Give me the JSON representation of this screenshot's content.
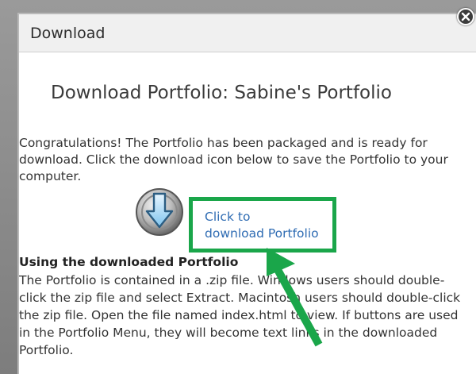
{
  "dialog": {
    "title": "Download",
    "close_icon": "close-icon"
  },
  "content": {
    "heading": "Download Portfolio: Sabine's Portfolio",
    "intro": "Congratulations! The Portfolio has been packaged and is ready for download. Click the download icon below to save the Portfolio to your computer.",
    "download_icon": "download-arrow-icon",
    "download_link_line1": "Click to",
    "download_link_line2": "download Portfolio",
    "using_heading": "Using the downloaded Portfolio",
    "using_body": "The Portfolio is contained in a .zip file. Windows users should double-click the zip file and select Extract. Macintosh users should double-click the zip file. Open the file named index.html to view. If buttons are used in the Portfolio Menu, they will become text links in the downloaded Portfolio."
  },
  "colors": {
    "highlight": "#1aa64a",
    "link": "#2f6cb3"
  }
}
